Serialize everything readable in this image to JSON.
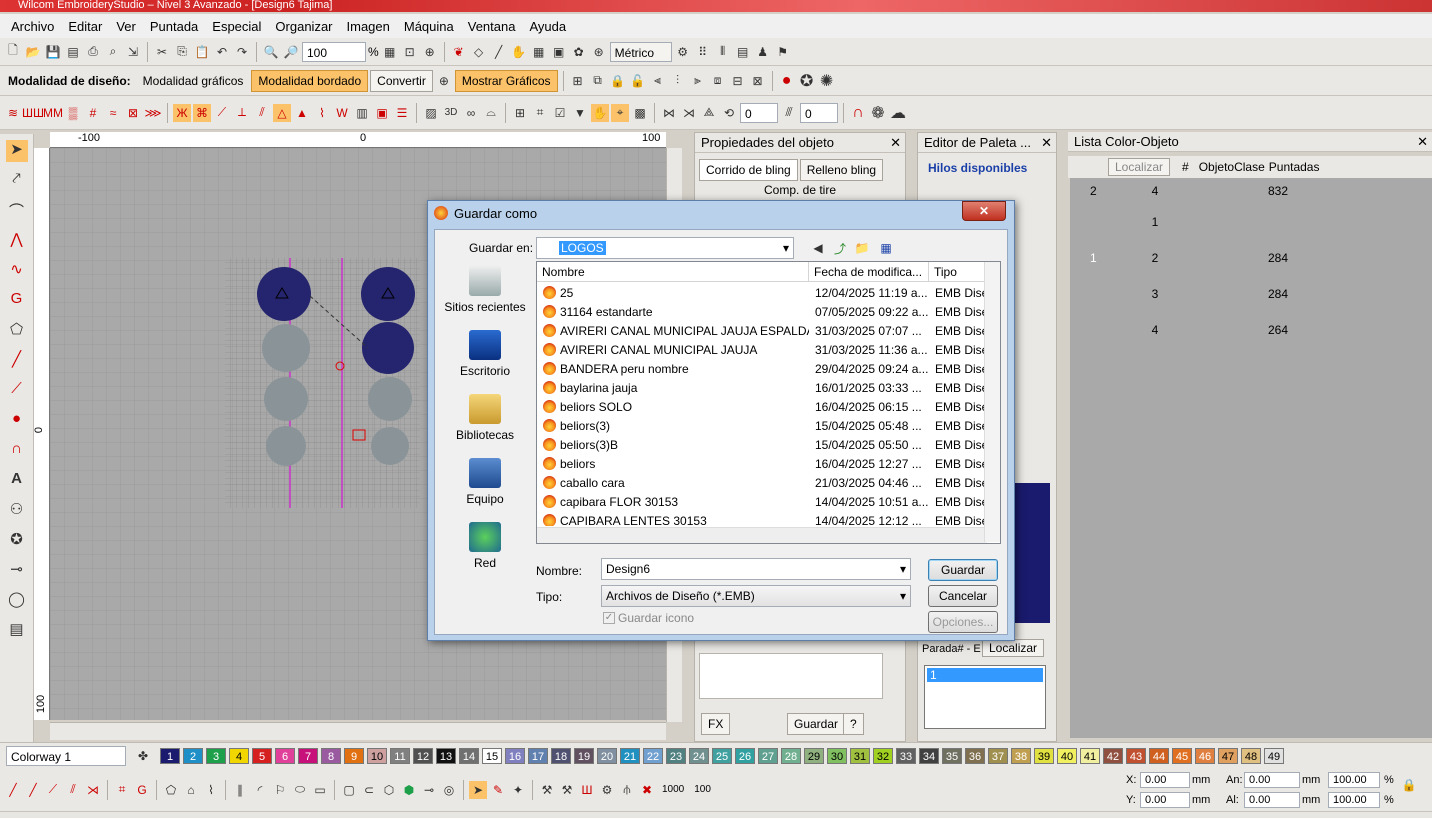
{
  "window": {
    "title": "Wilcom EmbroideryStudio – Nivel 3 Avanzado - [Design6     Tajima]"
  },
  "menu": [
    "Archivo",
    "Editar",
    "Ver",
    "Puntada",
    "Especial",
    "Organizar",
    "Imagen",
    "Máquina",
    "Ventana",
    "Ayuda"
  ],
  "toolbar1": {
    "zoom_value": "100",
    "zoom_unit": "%",
    "units": "Métrico"
  },
  "toolbar2": {
    "design_mode_label": "Modalidad de diseño:",
    "graphics_mode": "Modalidad gráficos",
    "embroidery_mode": "Modalidad bordado",
    "convert": "Convertir",
    "show_graphics": "Mostrar Gráficos"
  },
  "toolbar3": {
    "label_3d": "3D",
    "spin1": "0",
    "spin2": "0"
  },
  "rulers": {
    "h": [
      "-100",
      "0",
      "100"
    ],
    "v": [
      "0",
      "100"
    ]
  },
  "props_panel": {
    "title": "Propiedades del objeto",
    "tab1": "Corrido de bling",
    "tab2": "Relleno bling",
    "sub": "Comp. de tire",
    "fx": "FX",
    "save": "Guardar",
    "help": "?"
  },
  "palette_panel": {
    "title": "Editor de Paleta ...",
    "threads": "Hilos disponibles",
    "stop_label": "Parada# - E",
    "locate": "Localizar",
    "list_item": "1"
  },
  "colorobj_panel": {
    "title": "Lista Color-Objeto",
    "locate": "Localizar",
    "cols": [
      "#",
      "Objeto",
      "Clase",
      "Puntadas"
    ],
    "rows": [
      {
        "a": "2",
        "b": "4",
        "c": "",
        "d": "832"
      },
      {
        "a": "",
        "b": "1",
        "c": "",
        "d": ""
      },
      {
        "a": "1",
        "b": "2",
        "c": "",
        "d": "284"
      },
      {
        "a": "",
        "b": "3",
        "c": "",
        "d": "284"
      },
      {
        "a": "",
        "b": "4",
        "c": "",
        "d": "264"
      }
    ]
  },
  "dialog": {
    "title": "Guardar como",
    "save_in_label": "Guardar en:",
    "folder": "LOGOS",
    "places": [
      "Sitios recientes",
      "Escritorio",
      "Bibliotecas",
      "Equipo",
      "Red"
    ],
    "columns": [
      "Nombre",
      "Fecha de modifica...",
      "Tipo"
    ],
    "files": [
      {
        "name": "25",
        "date": "12/04/2025 11:19 a...",
        "type": "EMB Diseñ"
      },
      {
        "name": "31164 estandarte",
        "date": "07/05/2025 09:22 a...",
        "type": "EMB Diseñ"
      },
      {
        "name": "AVIRERI CANAL MUNICIPAL JAUJA ESPALDA",
        "date": "31/03/2025 07:07 ...",
        "type": "EMB Diseñ"
      },
      {
        "name": "AVIRERI CANAL MUNICIPAL JAUJA",
        "date": "31/03/2025 11:36 a...",
        "type": "EMB Diseñ"
      },
      {
        "name": "BANDERA peru nombre",
        "date": "29/04/2025 09:24 a...",
        "type": "EMB Diseñ"
      },
      {
        "name": "baylarina jauja",
        "date": "16/01/2025 03:33 ...",
        "type": "EMB Diseñ"
      },
      {
        "name": "beliors SOLO",
        "date": "16/04/2025 06:15 ...",
        "type": "EMB Diseñ"
      },
      {
        "name": "beliors(3)",
        "date": "15/04/2025 05:48 ...",
        "type": "EMB Diseñ"
      },
      {
        "name": "beliors(3)B",
        "date": "15/04/2025 05:50 ...",
        "type": "EMB Diseñ"
      },
      {
        "name": "beliors",
        "date": "16/04/2025 12:27 ...",
        "type": "EMB Diseñ"
      },
      {
        "name": "caballo cara",
        "date": "21/03/2025 04:46 ...",
        "type": "EMB Diseñ"
      },
      {
        "name": "capibara FLOR 30153",
        "date": "14/04/2025 10:51 a...",
        "type": "EMB Diseñ"
      },
      {
        "name": "CAPIBARA LENTES 30153",
        "date": "14/04/2025 12:12 ...",
        "type": "EMB Diseñ"
      }
    ],
    "name_label": "Nombre:",
    "name_value": "Design6",
    "type_label": "Tipo:",
    "type_value": "Archivos de Diseño (*.EMB)",
    "save_icon_label": "Guardar icono",
    "save_btn": "Guardar",
    "cancel_btn": "Cancelar",
    "options_btn": "Opciones..."
  },
  "colorway": {
    "label": "Colorway 1",
    "swatches": [
      "1",
      "2",
      "3",
      "4",
      "5",
      "6",
      "7",
      "8",
      "9",
      "10",
      "11",
      "12",
      "13",
      "14",
      "15",
      "16",
      "17",
      "18",
      "19",
      "20",
      "21",
      "22",
      "23",
      "24",
      "25",
      "26",
      "27",
      "28",
      "29",
      "30",
      "31",
      "32",
      "33",
      "34",
      "35",
      "36",
      "37",
      "38",
      "39",
      "40",
      "41",
      "42",
      "43",
      "44",
      "45",
      "46",
      "47",
      "48",
      "49"
    ],
    "colors": [
      "#1a1a6e",
      "#1f8fc8",
      "#1ea04a",
      "#f2d600",
      "#d62020",
      "#e0409a",
      "#c8107a",
      "#9a5aa0",
      "#e07010",
      "#cfa0a0",
      "#808080",
      "#505050",
      "#101010",
      "#707070",
      "#ffffff",
      "#8080c0",
      "#6080b0",
      "#505070",
      "#605060",
      "#8090a0",
      "#2090c0",
      "#70a0d0",
      "#508080",
      "#709090",
      "#40a0a0",
      "#30a0a0",
      "#60a090",
      "#70b090",
      "#90b080",
      "#80c060",
      "#a0c040",
      "#a0d020",
      "#606060",
      "#404040",
      "#707060",
      "#807050",
      "#a09050",
      "#c0a050",
      "#e0e040",
      "#f0f060",
      "#f0f0a0",
      "#905040",
      "#c05030",
      "#d06020",
      "#e07020",
      "#e08040",
      "#e0a060",
      "#e0c080",
      "#e0e0e0"
    ]
  },
  "coords": {
    "x_label": "X:",
    "x": "0.00",
    "x_unit": "mm",
    "y_label": "Y:",
    "y": "0.00",
    "y_unit": "mm",
    "an_label": "An:",
    "an": "0.00",
    "an_unit": "mm",
    "al_label": "Al:",
    "al": "0.00",
    "al_unit": "mm",
    "pct1": "100.00",
    "pct2": "100.00",
    "pct": "%",
    "num1000": "1000",
    "num100": "100"
  }
}
